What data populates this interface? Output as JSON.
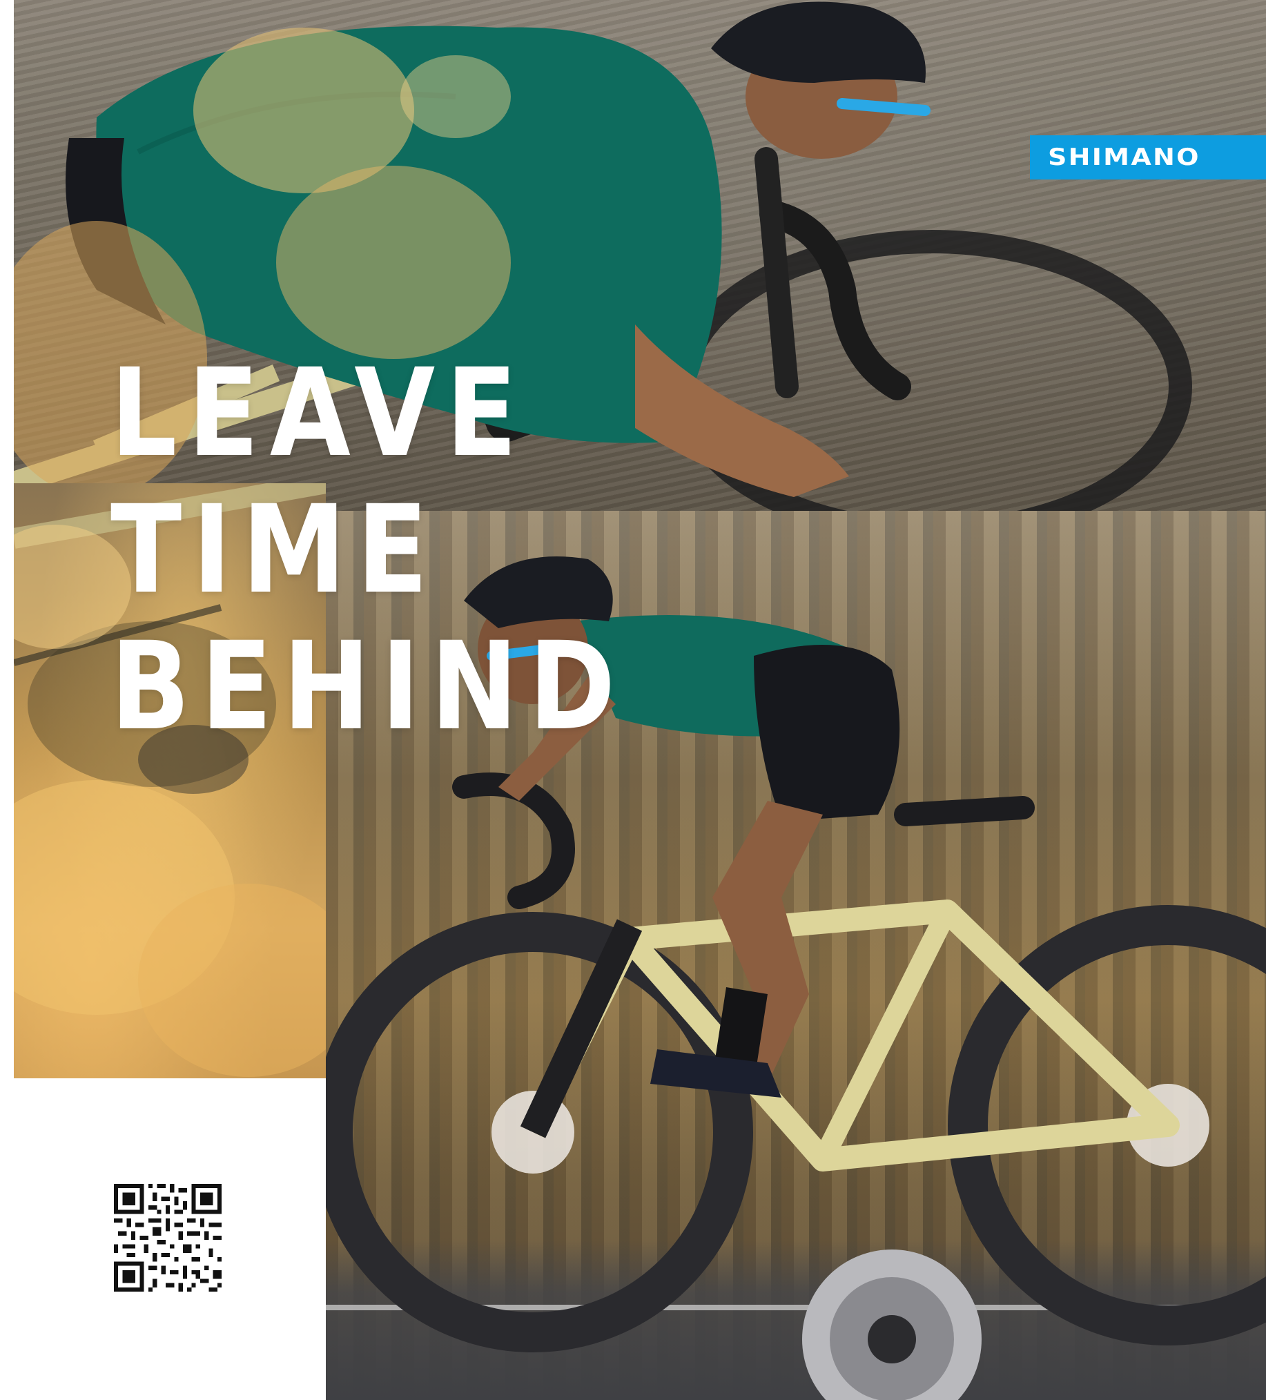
{
  "brand": {
    "name": "SHIMANO",
    "color": "#0d9de0"
  },
  "headline": {
    "lines": [
      "LEAVE",
      "TIME",
      "BEHIND"
    ]
  },
  "qr": {
    "icon": "qr-code-icon"
  },
  "photos": {
    "top": "cyclist-close-up",
    "bottom": "cyclist-side-view"
  }
}
